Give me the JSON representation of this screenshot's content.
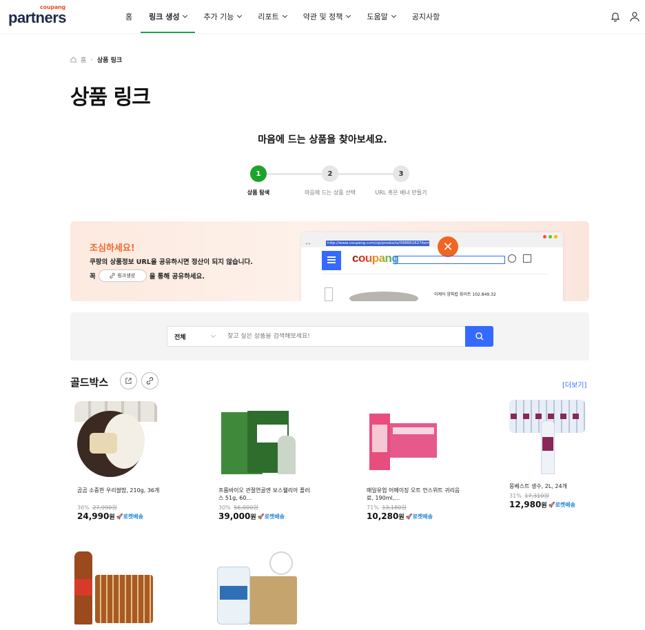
{
  "header": {
    "logo_small": "coupang",
    "logo_main": "partners",
    "nav": [
      {
        "label": "홈",
        "chevron": false,
        "active": false
      },
      {
        "label": "링크 생성",
        "chevron": true,
        "active": true
      },
      {
        "label": "추가 기능",
        "chevron": true,
        "active": false
      },
      {
        "label": "리포트",
        "chevron": true,
        "active": false
      },
      {
        "label": "약관 및 정책",
        "chevron": true,
        "active": false
      },
      {
        "label": "도움말",
        "chevron": true,
        "active": false
      },
      {
        "label": "공지사항",
        "chevron": false,
        "active": false
      }
    ]
  },
  "breadcrumb": {
    "home": "홈",
    "current": "상품 링크"
  },
  "page_title": "상품 링크",
  "subtitle": "마음에 드는 상품을 찾아보세요.",
  "steps": [
    {
      "num": "1",
      "label": "상품 탐색",
      "active": true
    },
    {
      "num": "2",
      "label": "마음에 드는 상품 선택",
      "active": false
    },
    {
      "num": "3",
      "label": "URL 혹은 배너 만들기",
      "active": false
    }
  ],
  "warning": {
    "title": "조심하세요!",
    "line1": "쿠팡의 상품정보 URL을 공유하시면 정산이 되지 않습니다.",
    "line2_prefix": "꼭",
    "pill": "링크생성",
    "line2_suffix": "을 통해 공유하세요.",
    "mock_url": "http://www.coupang.com/vp/products/568661627itemId",
    "mock_brand": "coupang",
    "mock_product": "이케아 양피캅 화이트 102.849.32"
  },
  "search": {
    "category": "전체",
    "placeholder": "찾고 싶은 상품을 검색해보세요!"
  },
  "goldbox": {
    "title": "골드박스",
    "more": "[더보기]",
    "products": [
      {
        "name": "곰곰 소중한 우리쌀밥, 210g, 36개",
        "discount": "36%",
        "original": "27,990원",
        "price": "24,990",
        "won": "원",
        "rocket": "로켓배송"
      },
      {
        "name": "프롬바이오 관절연골엔 보스웰리아 플러스 51g, 60…",
        "discount": "30%",
        "original": "56,000원",
        "price": "39,000",
        "won": "원",
        "rocket": "로켓배송"
      },
      {
        "name": "매일유업 어메이징 오트 언스위트 귀리음료, 190ml,…",
        "discount": "71%",
        "original": "13,180원",
        "price": "10,280",
        "won": "원",
        "rocket": "로켓배송"
      },
      {
        "name": "몽베스트 생수, 2L, 24개",
        "discount": "31%",
        "original": "17,310원",
        "price": "12,980",
        "won": "원",
        "rocket": "로켓배송"
      }
    ]
  },
  "colors": {
    "accent_green": "#1ea32a",
    "accent_blue": "#346aff",
    "warning_orange": "#ee6a2d"
  }
}
